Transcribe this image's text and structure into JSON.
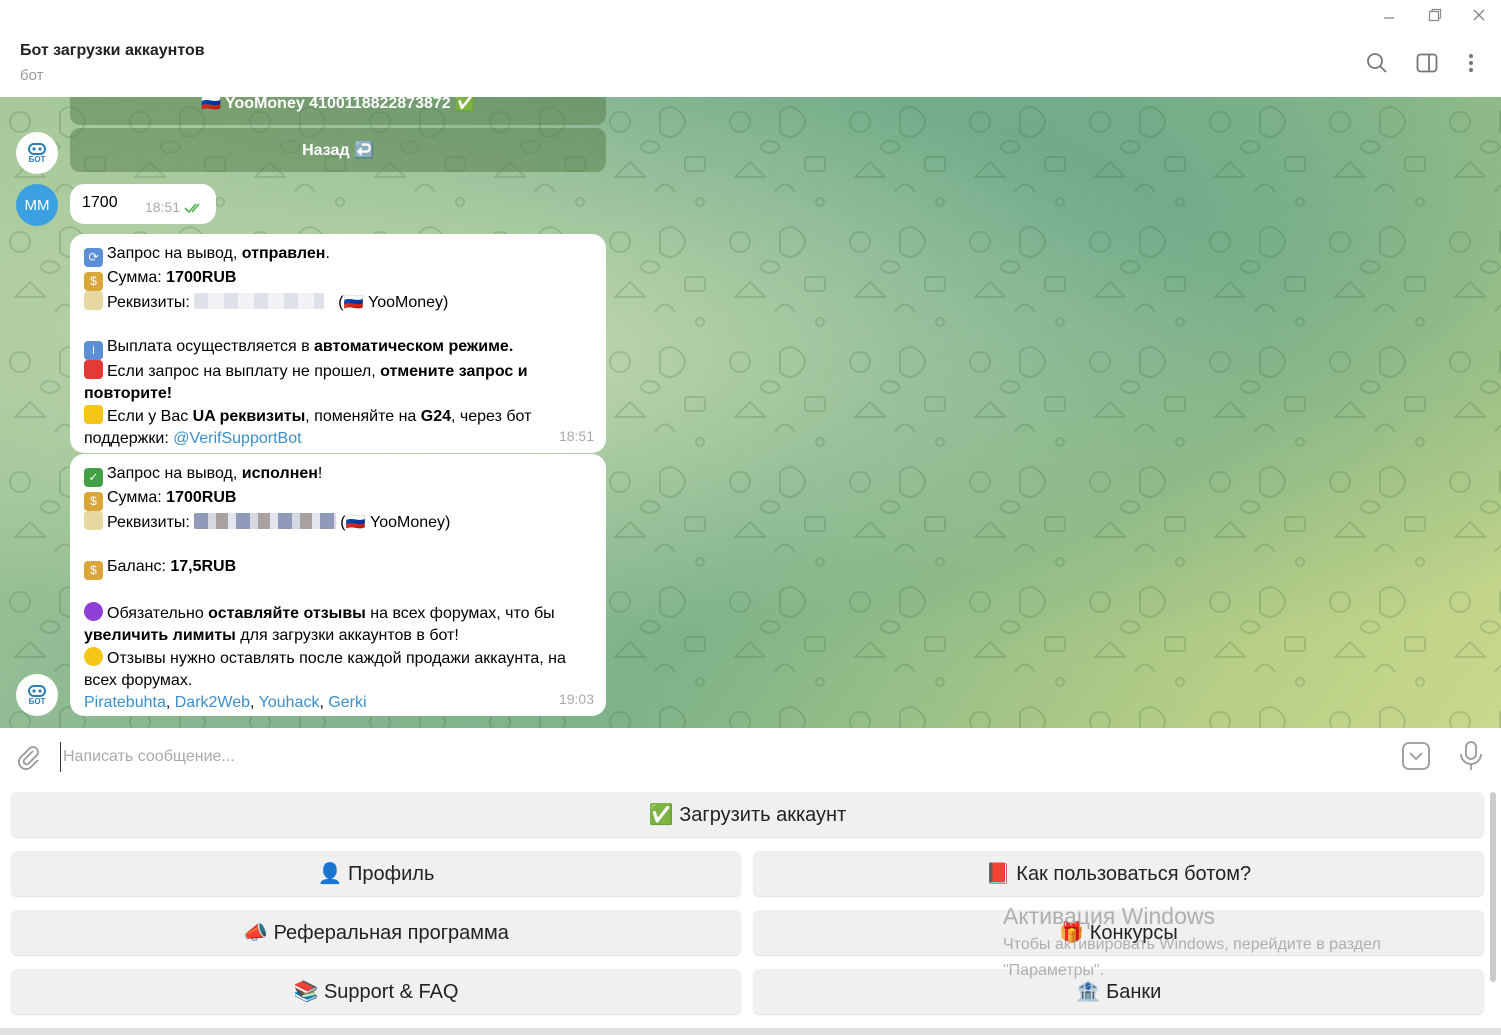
{
  "header": {
    "title": "Бот загрузки аккаунтов",
    "subtitle": "бот"
  },
  "chat": {
    "old_keyboard": [
      {
        "label": "🇷🇺 YooMoney 4100118822873872 ✅"
      },
      {
        "label": "Назад ↩️"
      }
    ],
    "bot_avatar_label": "БОТ",
    "user_avatar_label": "ММ",
    "user_message": {
      "text": "1700",
      "time": "18:51"
    },
    "msg1": {
      "l1a": "Запрос на вывод, ",
      "l1b": "отправлен",
      "l1c": ".",
      "l2a": "Сумма: ",
      "l2b": "1700RUB",
      "l3a": "Реквизиты: ",
      "l3b": "(🇷🇺 YooMoney)",
      "l4a": "Выплата осуществляется в ",
      "l4b": "автоматическом режиме.",
      "l5a": "Если запрос на выплату не прошел, ",
      "l5b": "отмените запрос и повторите!",
      "l6a": "Если у Вас ",
      "l6b": "UA реквизиты",
      "l6c": ", поменяйте на ",
      "l6d": "G24",
      "l6e": ", через бот поддержки: ",
      "l6link": "@VerifSupportBot",
      "time": "18:51"
    },
    "msg2": {
      "l1a": "Запрос на вывод, ",
      "l1b": "исполнен",
      "l1c": "!",
      "l2a": "Сумма: ",
      "l2b": "1700RUB",
      "l3a": "Реквизиты: ",
      "l3b": "(🇷🇺 YooMoney)",
      "l4a": "Баланс: ",
      "l4b": "17,5RUB",
      "l5a": "Обязательно ",
      "l5b": "оставляйте отзывы",
      "l5c": " на всех форумах, что бы ",
      "l5d": "увеличить лимиты",
      "l5e": " для загрузки аккаунтов в бот!",
      "l6": "Отзывы нужно оставлять после каждой продажи аккаунта, на всех форумах.",
      "links": [
        "Piratebuhta",
        "Dark2Web",
        "Youhack",
        "Gerki"
      ],
      "sep": ", ",
      "time": "19:03"
    }
  },
  "composer": {
    "placeholder": "Написать сообщение..."
  },
  "keyboard": {
    "upload": "✅ Загрузить аккаунт",
    "profile": "👤 Профиль",
    "howto": "📕 Как пользоваться ботом?",
    "referral": "📣 Реферальная программа",
    "contests": "🎁 Конкурсы",
    "support": "📚 Support & FAQ",
    "banks": "🏦 Банки"
  },
  "watermark": {
    "title": "Активация Windows",
    "line1": "Чтобы активировать Windows, перейдите в раздел",
    "line2": "\"Параметры\"."
  }
}
